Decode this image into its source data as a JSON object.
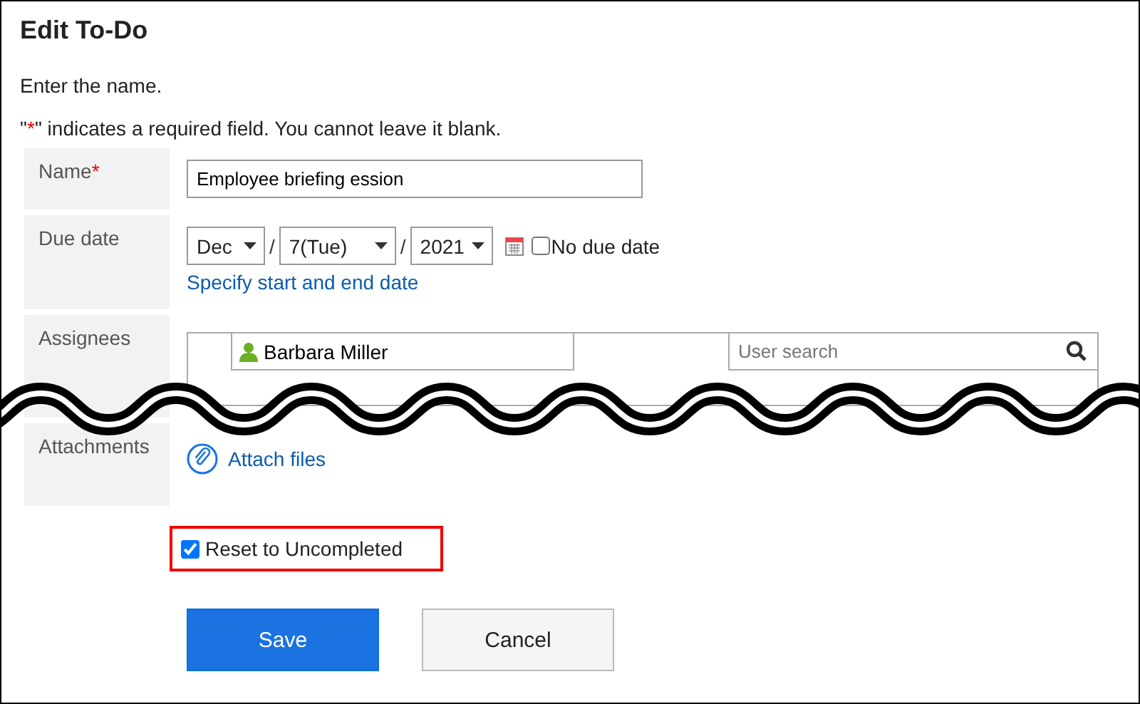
{
  "title": "Edit To-Do",
  "intro": "Enter the name.",
  "required_note": {
    "open": "\"",
    "mark": "*",
    "close": "\" indicates a required field. You cannot leave it blank."
  },
  "fields": [
    {
      "kind": "text",
      "label": "Name",
      "required": true,
      "value": "Employee briefing ession"
    },
    {
      "kind": "date",
      "label": "Due date",
      "required": false,
      "month": "Dec",
      "day": "7(Tue)",
      "year": "2021",
      "separator": "/",
      "no_due_date": {
        "label": "No due date",
        "checked": false
      },
      "link": "Specify start and end date"
    },
    {
      "kind": "assignees",
      "label": "Assignees",
      "required": false,
      "users": [
        "Barbara Miller"
      ],
      "search_placeholder": "User search"
    },
    {
      "kind": "attachments",
      "label": "Attachments",
      "required": false,
      "link": "Attach files"
    }
  ],
  "reset_option": {
    "label": "Reset to Uncompleted",
    "checked": true,
    "highlighted": true
  },
  "buttons": [
    {
      "label": "Save",
      "primary": true
    },
    {
      "label": "Cancel",
      "primary": false
    }
  ]
}
